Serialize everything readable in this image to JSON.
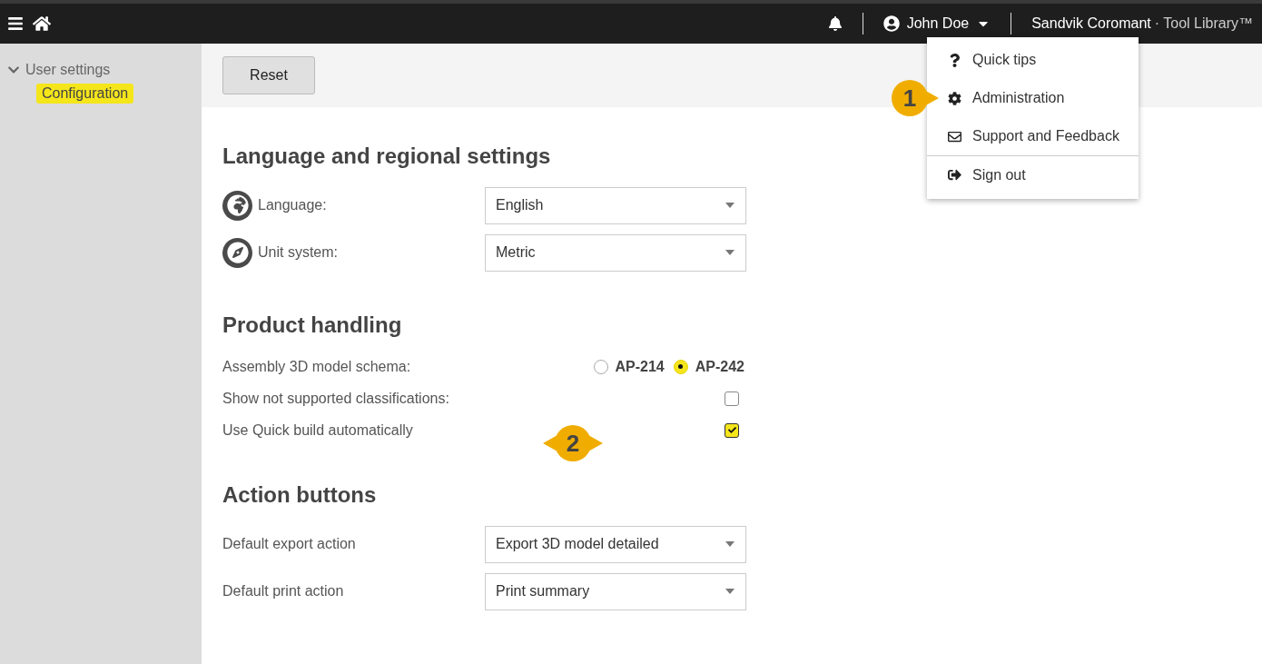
{
  "topbar": {
    "user": "John Doe",
    "brand": "Sandvik Coromant",
    "product": "· Tool Library™"
  },
  "user_menu": {
    "open": true,
    "items": [
      {
        "kind": "tips",
        "label": "Quick tips",
        "separated": false
      },
      {
        "kind": "admin",
        "label": "Administration",
        "separated": false
      },
      {
        "kind": "support",
        "label": "Support and Feedback",
        "separated": false
      },
      {
        "kind": "signout",
        "label": "Sign out",
        "separated": true
      }
    ]
  },
  "sidebar": {
    "items": [
      {
        "label": "User settings",
        "expanded": true,
        "children": [
          {
            "label": "Configuration",
            "selected": true
          }
        ]
      }
    ]
  },
  "toolbar": {
    "buttons": [
      "Reset"
    ]
  },
  "sections": [
    {
      "title": "Language and regional settings",
      "rows": [
        {
          "kind": "select",
          "label": "Language:",
          "value": "English"
        },
        {
          "kind": "select",
          "label": "Unit system:",
          "value": "Metric"
        }
      ]
    },
    {
      "title": "Product handling",
      "rows": [
        {
          "kind": "radio",
          "label": "Assembly 3D model schema:",
          "options": [
            {
              "label": "AP-214",
              "selected": false
            },
            {
              "label": "AP-242",
              "selected": true
            }
          ]
        },
        {
          "kind": "checkbox",
          "label": "Show not supported classifications:",
          "checked": false
        },
        {
          "kind": "checkbox",
          "label": "Use Quick build automatically",
          "checked": true
        }
      ]
    },
    {
      "title": "Action buttons",
      "rows": [
        {
          "kind": "select",
          "label": "Default export action",
          "value": "Export 3D model detailed"
        },
        {
          "kind": "select",
          "label": "Default print action",
          "value": "Print summary"
        }
      ]
    }
  ],
  "callouts": [
    {
      "label": "1",
      "kind": "single"
    },
    {
      "label": "2",
      "kind": "double"
    }
  ]
}
